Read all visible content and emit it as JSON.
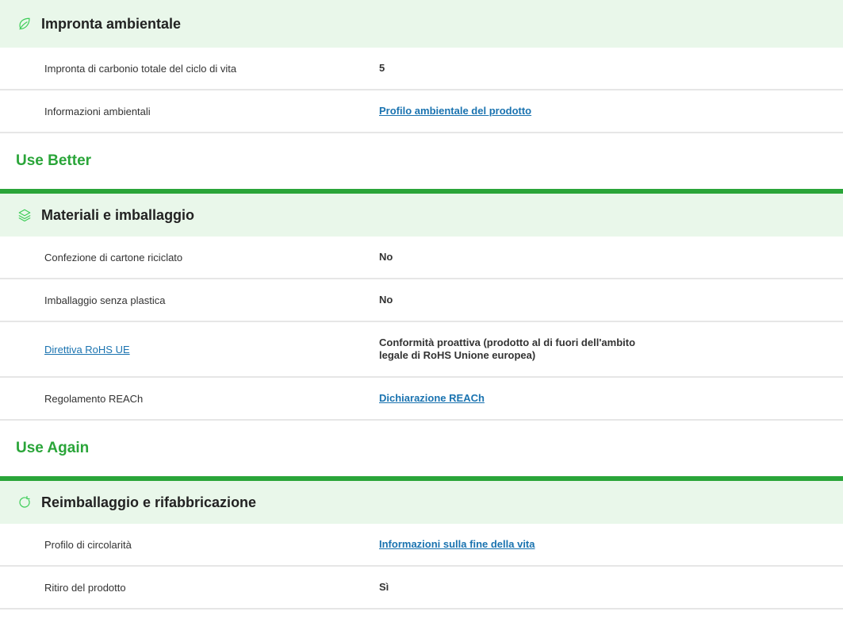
{
  "colors": {
    "accent_green": "#2aa539",
    "header_bg": "#e9f7ea",
    "link": "#1a73b0",
    "divider": "#e6e6e6"
  },
  "section1": {
    "icon": "leaf-icon",
    "title": "Impronta ambientale",
    "rows": [
      {
        "label": "Impronta di carbonio totale del ciclo di vita",
        "value": "5"
      },
      {
        "label": "Informazioni ambientali",
        "value": "Profilo ambientale del prodotto"
      }
    ]
  },
  "group2": {
    "heading": "Use Better"
  },
  "section2": {
    "icon": "layers-icon",
    "title": "Materiali e imballaggio",
    "rows": [
      {
        "label": "Confezione di cartone riciclato",
        "value": "No"
      },
      {
        "label": "Imballaggio senza plastica",
        "value": "No"
      },
      {
        "label": "Direttiva RoHS UE",
        "value_line1": "Conformità proattiva (prodotto al di fuori dell'ambito",
        "value_line2": "legale di RoHS Unione europea)"
      },
      {
        "label": "Regolamento REACh",
        "value": "Dichiarazione REACh"
      }
    ]
  },
  "group3": {
    "heading": "Use Again"
  },
  "section3": {
    "icon": "refresh-icon",
    "title": "Reimballaggio e rifabbricazione",
    "rows": [
      {
        "label": "Profilo di circolarità",
        "value": "Informazioni sulla fine della vita"
      },
      {
        "label": "Ritiro del prodotto",
        "value": "Sì"
      }
    ]
  }
}
